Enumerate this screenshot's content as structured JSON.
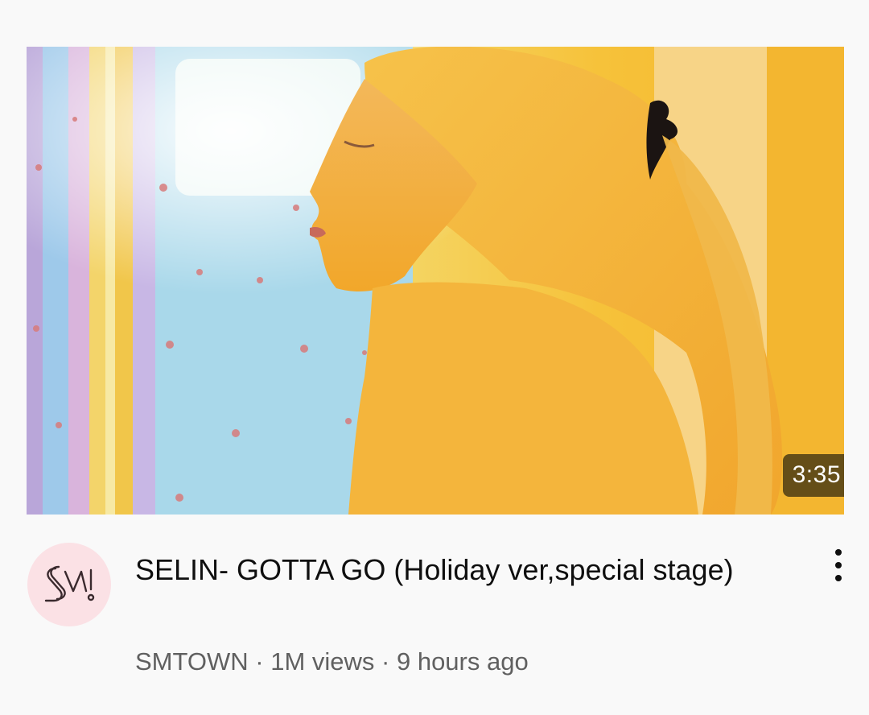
{
  "video": {
    "duration": "3:35",
    "title": "SELIN- GOTTA GO (Holiday ver,special stage)",
    "channel": "SMTOWN",
    "views": "1M views",
    "age": "9 hours ago",
    "separator": " · "
  },
  "icons": {
    "avatar": "sm-logo-icon",
    "menu": "more-vert-icon"
  },
  "colors": {
    "avatar_bg": "#fbe1e5",
    "avatar_logo": "#3a2a2e",
    "meta_text": "#606060",
    "title_text": "#0f0f0f"
  }
}
